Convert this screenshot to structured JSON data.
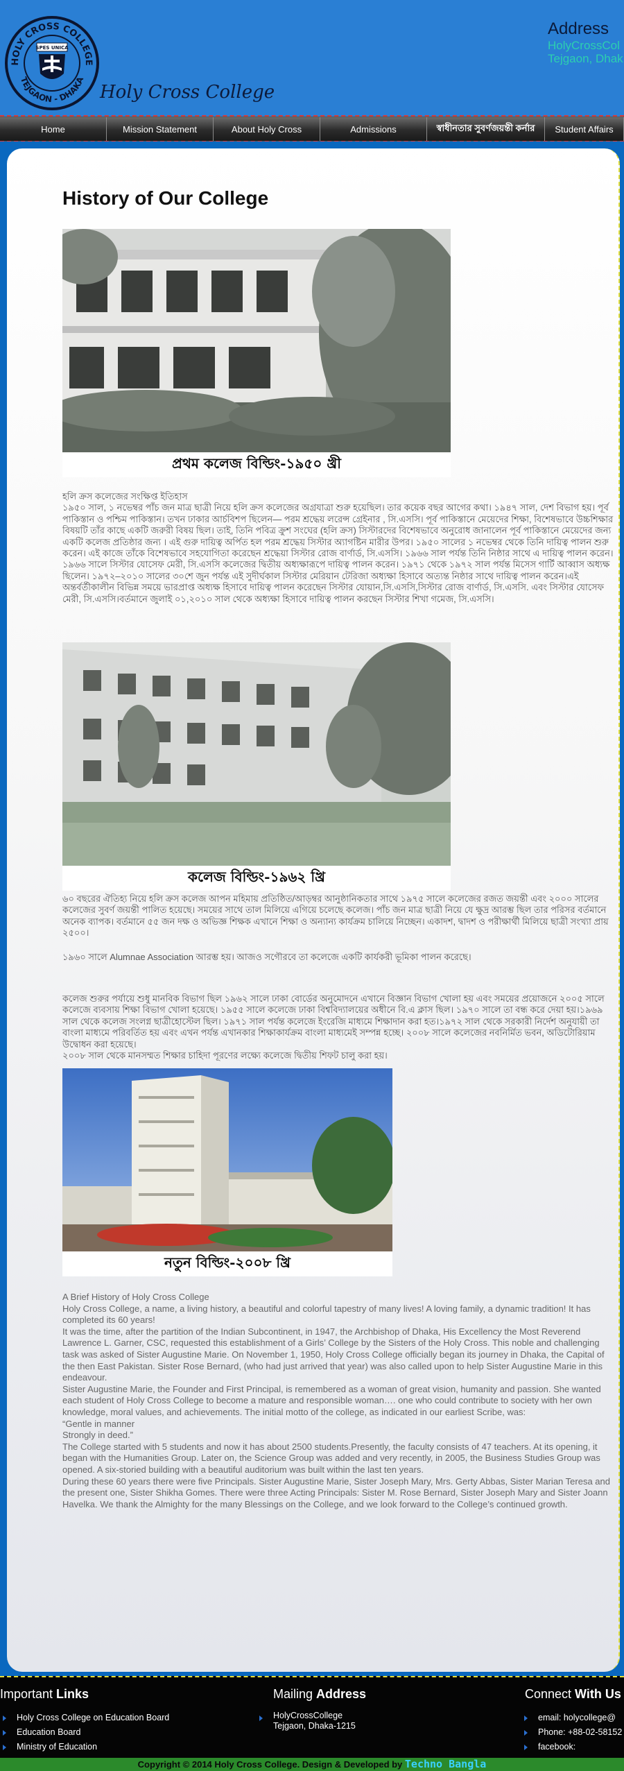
{
  "header": {
    "seal_text_top": "HOLY CROSS COLLEGE",
    "seal_text_bottom": "TEJGAON - DHAKA",
    "seal_motto": "SPES UNICA",
    "script_name": "Holy Cross College",
    "address_title": "Address",
    "address_line1": "HolyCrossCol",
    "address_line2": "Tejgaon, Dhak"
  },
  "nav": [
    {
      "label": "Home"
    },
    {
      "label": "Mission Statement"
    },
    {
      "label": "About Holy Cross"
    },
    {
      "label": "Admissions"
    },
    {
      "label": "স্বাধীনতার সুবর্ণজয়ন্তী কর্নার"
    },
    {
      "label": "Student Affairs"
    }
  ],
  "page_title": "History of Our College",
  "photos": {
    "p1_caption": "প্রথম কলেজ বিল্ডিং-১৯৫০ খ্রী",
    "p2_caption": "কলেজ বিল্ডিং-১৯৬২   খ্রি",
    "p3_caption": "নতুন বিল্ডিং-২০০৮ খ্রি"
  },
  "bangla": {
    "b1": "হলি ক্রস কলেজের সংক্ষিপ্ত ইতিহাস\n১৯৫০ সাল, ১ নভেম্বর পাঁচ জন মাত্র ছাত্রী নিয়ে হলি ক্রস কলেজের অগ্রযাত্রা শুরু হয়েছিল।  তার কয়েক বছর  আগের কথা। ১৯৪৭ সাল, দেশ বিভাগ হয়। পূর্ব পাকিস্তান ও পশ্চিম পাকিস্তান। তখন ঢাকার আর্চবিশপ  ছিলেন— পরম শ্রদ্ধেয় লরেন্স গ্রেইনার , সি.এসসি। পূর্ব পাকিস্তানে মেয়েদের শিক্ষা, বিশেষভাবে উচ্চশিক্ষার বিষয়টি তাঁর কাছে একটি জরুরী বিষয় ছিল। তাই, তিনি পবিত্র ক্রুশ সংঘের (হলি ক্রস) সিস্টারদের বিশেষভাবে অনুরোধ জানালেন পূর্ব পাকিস্তানে মেয়েদের জন্য একটি কলেজ প্রতিষ্ঠার জন্য । এই গুরু দায়িত্ব অর্পিত হল  পরম শ্রদ্ধেয় সিস্টার অ্যাগষ্টিন মারীর উপর। ১৯৫০ সালের ১ নভেম্বর থেকে তিনি দায়িত্ব  পালন শুরু করেন। এই কাজে তাঁকে বিশেষভাবে সহযোগিতা করেছেন শ্রদ্ধেয়া সিস্টার রোজ  বার্ণার্ড, সি.এসসি।  ১৯৬৬ সাল পর্যন্ত তিনি নিষ্ঠার সাথে এ দায়িত্ব পালন করেন। ১৯৬৬ সালে সিস্টার যোসেফ মেরী, সি.এসসি কলেজের দ্বিতীয় অধ্যক্ষারূপে দায়িত্ব পালন করেন। ১৯৭১ থেকে ১৯৭২ সাল পর্যন্ত মিসেস গার্টি আব্বাস অধ্যক্ষ ছিলেন। ১৯৭২–২০১০ সালের ৩০শে জুন পর্যন্ত এই সুদীর্ঘকাল সিস্টার মেরিয়ান টেরিজা অধ্যক্ষা হিসাবে অত্যন্ত নিষ্ঠার সাথে দায়িত্ব পালন করেন।এই অন্তর্বর্তীকালীন  বিভিন্ন সময়ে ভারপ্রাপ্ত অধ্যক্ষ হিসাবে দায়িত্ব পালন করেছেন সিস্টার যোয়ান,সি.এসসি,সিস্টার রোজ বার্ণার্ড, সি.এসসি. এবং সিস্টার যোসেফ মেরী, সি.এসসি।বর্তমানে জুলাই ০১,২০১০ সাল থেকে অধ্যক্ষা হিসাবে দায়িত্ব পালন করছেন সিস্টার শিখা গমেজ, সি.এসসি।",
    "b2": "৬০ বছরের ঐতিহ্য নিয়ে হলি ক্রস কলেজ আপন মহিমায় প্রতিষ্ঠিত/আড়ম্বর আনুষ্ঠানিকতার সাথে ১৯৭৫ সালে কলেজের রজত জয়ন্তী এবং ২০০০ সালের কলেজের সুবর্ণ জয়ন্তী পালিত হয়েছে। সময়ের সাথে তাল মিলিয়ে এগিয়ে  চলেছে কলেজ। পাঁচ জন মাত্র ছাত্রী নিয়ে  যে ক্ষুদ্র আরম্ভ ছিল তার পরিসর বর্তমানে অনেক ব্যাপক। বর্তমানে ৫৫ জন দক্ষ ও  অভিজ্ঞ শিক্ষক এখানে শিক্ষা ও অন্যান্য কার্যক্রম চালিয়ে নিচ্ছেন।  একাদশ, দ্বাদশ ও পরীক্ষার্থী মিলিয়ে ছাত্রী সংখ্যা প্রায় ২৫০০।",
    "b3": "১৯৬০ সালে Alumnae Association আরম্ভ হয়।   আজও সগৌরবে তা কলেজে একটি কার্যকরী ভূমিকা পালন করেছে।",
    "b4": "কলেজ শুরুর পর্যায়ে শুধু মানবিক বিভাগ ছিল ১৯৬২ সালে ঢাকা বোর্ডের অনুমোদনে এখানে বিজ্ঞান বিভাগ খোলা হয় এবং সময়ের প্রয়োজনে ২০০৫ সালে কলেজে ব্যবসায় শিক্ষা বিভাগ খোলা হয়েছে। ১৯৫৫ সালে কলেজে ঢাকা বিশ্ববিদ্যালয়ের অধীনে বি.এ ক্লাস ছিল। ১৯৭০ সালে তা বন্ধ করে দেয়া হয়।১৯৬৯ সাল থেকে কলেজ সংলগ্ন ছাত্রীহোস্টেল ছিল। ১৯৭১ সাল পর্যন্ত  কলেজে ইংরেজি মাধ্যমে শিক্ষাদান করা হত।১৯৭২ সাল থেকে সরকারী নির্দেশ অনুযায়ী তা বাংলা মাধ্যমে পরিবর্তিত হয় এবং এখন পর্যন্ত এখানকার শিক্ষাকার্যক্রম বাংলা মাধ্যমেই সম্পন্ন হচ্ছে। ২০০৮ সালে কলেজের নবনির্মিত ভবন, অডিটোরিয়াম উদ্বোধন করা হয়েছে।\n২০০৮ সাল থেকে মানসম্মত শিক্ষার চাহিদা পূরণের  লক্ষ্যে কলেজে দ্বিতীয় শিফট চালু  করা হয়।"
  },
  "english": {
    "heading": "A Brief History of Holy Cross College",
    "p1": "Holy Cross College, a name, a living history, a beautiful and colorful tapestry of many lives! A loving family, a dynamic tradition! It has completed its 60 years!",
    "p2": "It was the time, after the partition of the Indian Subcontinent, in 1947, the Archbishop of Dhaka, His Excellency the Most Reverend Lawrence L. Garner, CSC, requested this establishment of a Girls’ College by the Sisters of the Holy Cross. This noble and challenging task was asked of Sister Augustine Marie. On November 1, 1950, Holy Cross College officially began its journey in Dhaka, the Capital of the then East Pakistan. Sister Rose Bernard, (who had just arrived that year) was also called upon to help Sister Augustine Marie in this endeavour.",
    "p3": "Sister Augustine Marie, the Founder and First Principal, is remembered as a woman of great vision, humanity and passion. She wanted each student of Holy Cross College to become a mature and responsible woman…. one who could contribute to society with her own knowledge, moral values, and achievements. The initial motto of the college, as indicated in our earliest Scribe, was:",
    "p4": "“Gentle in manner",
    "p5": "Strongly in deed.”",
    "p6": "The College started with 5 students and now it has about 2500 students.Presently, the faculty consists of 47 teachers. At its opening, it began with the Humanities Group. Later on, the Science Group was added and very recently, in 2005, the Business Studies Group was opened. A six-storied building with a beautiful auditorium was built within the last ten years.",
    "p7": "During these 60 years there were five Principals.  Sister Augustine Marie, Sister Joseph Mary, Mrs. Gerty Abbas, Sister Marian Teresa and the present one, Sister Shikha Gomes. There were three Acting Principals: Sister M. Rose Bernard, Sister Joseph Mary and Sister Joann Havelka. We thank the Almighty for the many Blessings on the College, and we look forward to the College’s continued growth."
  },
  "footer": {
    "links_head_a": "Important ",
    "links_head_b": "Links",
    "links": [
      "Holy Cross College on Education Board",
      "Education Board",
      "Ministry of Education"
    ],
    "mail_head_a": "Mailing ",
    "mail_head_b": "Address",
    "mail_line1": "HolyCrossCollege",
    "mail_line2": "Tejgaon, Dhaka-1215",
    "connect_head_a": "Connect ",
    "connect_head_b": "With Us",
    "connect": [
      "email: holycollege@",
      "Phone: +88-02-58152",
      "facebook:"
    ],
    "copyright": "Copyright © 2014 Holy Cross College. Design & Developed by ",
    "brand": "Techno Bangla"
  }
}
